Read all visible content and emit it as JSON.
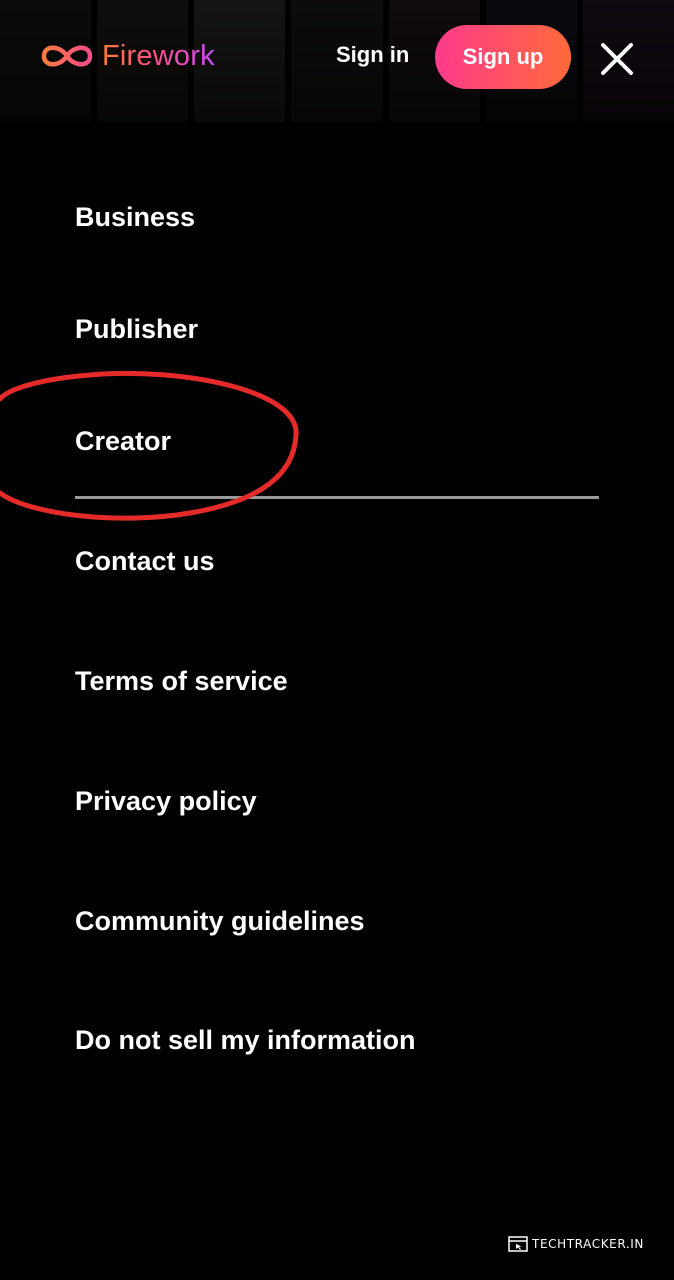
{
  "header": {
    "logo_text": "Firework",
    "signin_label": "Sign in",
    "signup_label": "Sign up",
    "close_icon": "close-icon"
  },
  "menu": {
    "items": [
      {
        "label": "Business"
      },
      {
        "label": "Publisher"
      },
      {
        "label": "Creator"
      },
      {
        "label": "Contact us"
      },
      {
        "label": "Terms of service"
      },
      {
        "label": "Privacy policy"
      },
      {
        "label": "Community guidelines"
      },
      {
        "label": "Do not sell my information"
      }
    ]
  },
  "watermark": {
    "text": "TechTracker.in"
  },
  "colors": {
    "background": "#000000",
    "text": "#ffffff",
    "brand_gradient_start": "#ff7a3d",
    "brand_gradient_end": "#c94bff",
    "signup_gradient_start": "#ff3a8c",
    "signup_gradient_end": "#ff6a3a",
    "annotation": "#e52a2a",
    "divider": "#9a9a9a"
  }
}
